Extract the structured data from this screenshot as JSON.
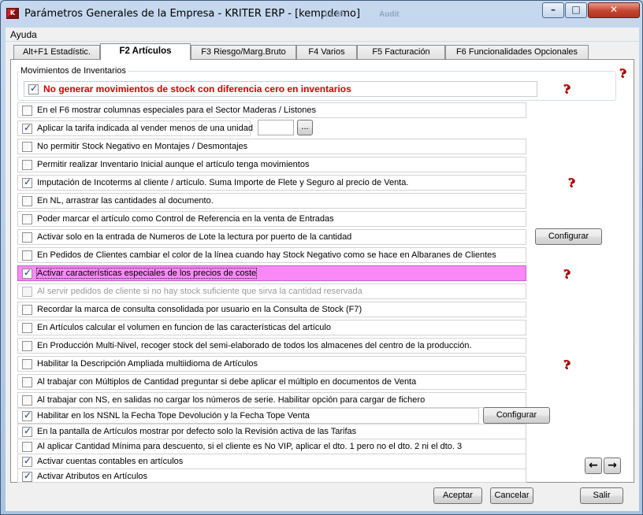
{
  "window": {
    "title": "Parámetros Generales de la Empresa - KRITER ERP - [kempdemo]",
    "background_ghost": [
      "14:06",
      "Audit"
    ]
  },
  "menu": {
    "items": [
      "Ayuda"
    ]
  },
  "tabs": [
    {
      "label": "Alt+F1 Estadístic.",
      "active": false
    },
    {
      "label": "F2 Artículos",
      "active": true
    },
    {
      "label": "F3 Riesgo/Marg.Bruto",
      "active": false
    },
    {
      "label": "F4 Varios",
      "active": false
    },
    {
      "label": "F5 Facturación",
      "active": false
    },
    {
      "label": "F6 Funcionalidades Opcionales",
      "active": false
    }
  ],
  "group": {
    "legend": "Movimientos de Inventarios",
    "option": {
      "label": "No generar movimientos de stock con diferencia cero en inventarios",
      "checked": true
    }
  },
  "options": [
    {
      "label": "En el F6 mostrar columnas especiales para el Sector Maderas / Listones",
      "checked": false
    },
    {
      "label": "Aplicar la tarifa indicada al vender menos de una unidad",
      "checked": true,
      "input_value": "",
      "browse_label": "..."
    },
    {
      "label": "No permitir Stock Negativo en Montajes / Desmontajes",
      "checked": false
    },
    {
      "label": "Permitir realizar Inventario Inicial aunque el artículo tenga movimientos",
      "checked": false
    },
    {
      "label": "Imputación de Incoterms al cliente / artículo.  Suma Importe de Flete y Seguro al precio de Venta.",
      "checked": true
    },
    {
      "label": "En NL, arrastrar las cantidades al documento.",
      "checked": false
    },
    {
      "label": "Poder marcar el artículo como Control de Referencia en la venta de Entradas",
      "checked": false
    },
    {
      "label": "Activar solo en la entrada de Numeros de Lote la lectura por puerto de la cantidad",
      "checked": false,
      "button_label": "Configurar"
    },
    {
      "label": "En Pedidos de Clientes cambiar el color de la línea cuando hay Stock Negativo como se hace en Albaranes de Clientes",
      "checked": false
    },
    {
      "label": "Activar características especiales de los precios de coste",
      "checked": true
    },
    {
      "label": "Al servir pedidos de cliente si no hay stock suficiente que sirva la cantidad reservada",
      "checked": false
    },
    {
      "label": "Recordar la marca de consulta consolidada por usuario en la Consulta de Stock (F7)",
      "checked": false
    },
    {
      "label": "En Artículos calcular el volumen en funcion de las características del artículo",
      "checked": false
    },
    {
      "label": "En Producción Multi-Nivel, recoger stock del semi-elaborado de todos los almacenes del centro de la producción.",
      "checked": false
    },
    {
      "label": "Habilitar la Descripción Ampliada multiidioma de Artículos",
      "checked": false
    },
    {
      "label": "Al trabajar con Múltiplos de Cantidad preguntar si debe aplicar el múltiplo en documentos de Venta",
      "checked": false
    },
    {
      "label": "Al trabajar con NS, en salidas no cargar los números de serie. Habilitar opción para cargar de fichero",
      "checked": false
    },
    {
      "label": "Habilitar en los NSNL la Fecha Tope Devolución y la Fecha Tope Venta",
      "checked": true,
      "button_label": "Configurar"
    },
    {
      "label": "En la pantalla de Artículos mostrar por defecto solo la Revisión activa de las Tarifas",
      "checked": true
    },
    {
      "label": "Al aplicar Cantidad Mínima para descuento, si el cliente es No VIP, aplicar el dto. 1 pero no el dto. 2 ni el dto. 3",
      "checked": false
    },
    {
      "label": "Activar cuentas contables en artículos",
      "checked": true
    },
    {
      "label": "Activar Atributos en Artículos",
      "checked": true
    }
  ],
  "footer": {
    "accept_label": "Aceptar",
    "cancel_label": "Cancelar",
    "exit_label": "Salir"
  },
  "icons": {
    "help": "?",
    "prev": "←",
    "next": "→"
  },
  "colors": {
    "title_red": "#d00000",
    "highlight_pink": "#f889f7"
  }
}
